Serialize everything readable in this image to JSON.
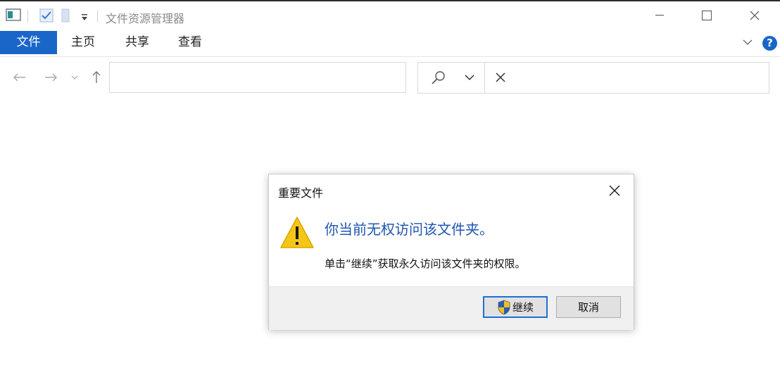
{
  "window": {
    "title": "文件资源管理器"
  },
  "ribbon": {
    "tabs": [
      {
        "label": "文件",
        "active": true
      },
      {
        "label": "主页",
        "active": false
      },
      {
        "label": "共享",
        "active": false
      },
      {
        "label": "查看",
        "active": false
      }
    ],
    "help_label": "?"
  },
  "address": {
    "value": ""
  },
  "search": {
    "value": ""
  },
  "dialog": {
    "title": "重要文件",
    "message": "你当前无权访问该文件夹。",
    "detail": "单击“继续”获取永久访问该文件夹的权限。",
    "continue_label": "继续",
    "cancel_label": "取消"
  },
  "colors": {
    "accent": "#1a66c8",
    "dialog_heading": "#1f56b0",
    "warning": "#f5c518"
  }
}
